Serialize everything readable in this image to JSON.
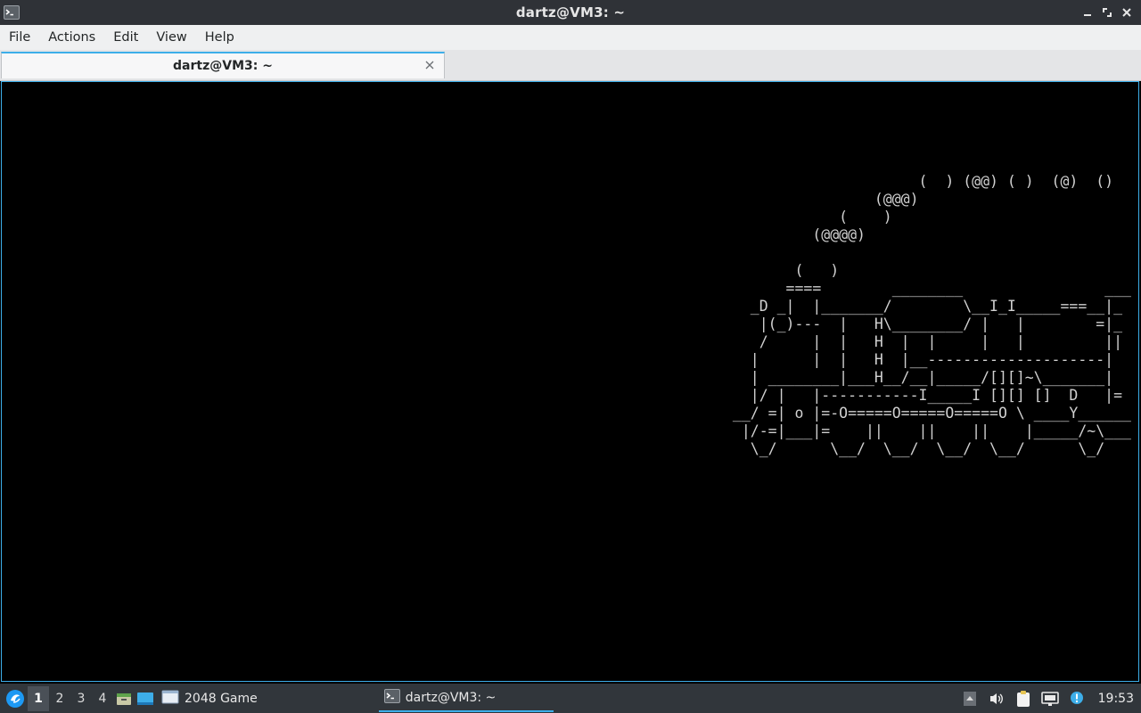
{
  "window": {
    "title": "dartz@VM3: ~"
  },
  "menu": {
    "items": [
      "File",
      "Actions",
      "Edit",
      "View",
      "Help"
    ]
  },
  "tabs": [
    {
      "label": "dartz@VM3: ~"
    }
  ],
  "terminal": {
    "output": "                      (  ) (@@) ( )  (@)  ()\n                 (@@@)\n             (    )\n          (@@@@)\n\n        (   )\n       ====        ________                ___\n   _D _|  |_______/        \\__I_I_____===__|_\n    |(_)---  |   H\\________/ |   |        =|_\n    /     |  |   H  |  |     |   |         ||\n   |      |  |   H  |__--------------------|\n   | ________|___H__/__|_____/[][]~\\_______|\n   |/ |   |-----------I_____I [][] []  D   |=\n __/ =| o |=-O=====O=====O=====O \\ ____Y______\n  |/-=|___|=    ||    ||    ||    |_____/~\\___\n   \\_/      \\__/  \\__/  \\__/  \\__/      \\_/"
  },
  "taskbar": {
    "desktops": [
      "1",
      "2",
      "3",
      "4"
    ],
    "active_desktop": "1",
    "tasks": [
      {
        "label": "2048 Game",
        "icon": "window-icon"
      },
      {
        "label": "dartz@VM3: ~",
        "icon": "terminal-icon"
      }
    ],
    "clock": "19:53"
  },
  "colors": {
    "accent": "#3daee9",
    "titlebar": "#2f3237",
    "taskbar": "#31363b",
    "menubar": "#eff0f1",
    "terminal_bg": "#000000",
    "terminal_fg": "#d0d0d0"
  }
}
